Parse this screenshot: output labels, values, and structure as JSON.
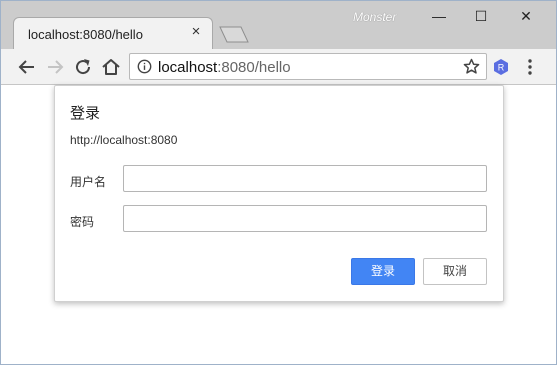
{
  "window": {
    "profile_name": "Monster",
    "controls": {
      "minimize": "—",
      "maximize": "☐",
      "close": "✕"
    }
  },
  "tab": {
    "title": "localhost:8080/hello",
    "close": "×"
  },
  "toolbar": {
    "url_host": "localhost",
    "url_rest": ":8080/hello",
    "extension_letter": "R"
  },
  "dialog": {
    "title": "登录",
    "origin": "http://localhost:8080",
    "username_label": "用户名",
    "password_label": "密码",
    "username_value": "",
    "password_value": "",
    "login_button": "登录",
    "cancel_button": "取消"
  },
  "colors": {
    "accent": "#4285f4",
    "titlebar": "#cccccc",
    "toolbar": "#f2f2f2",
    "extension": "#5b6ee1"
  }
}
